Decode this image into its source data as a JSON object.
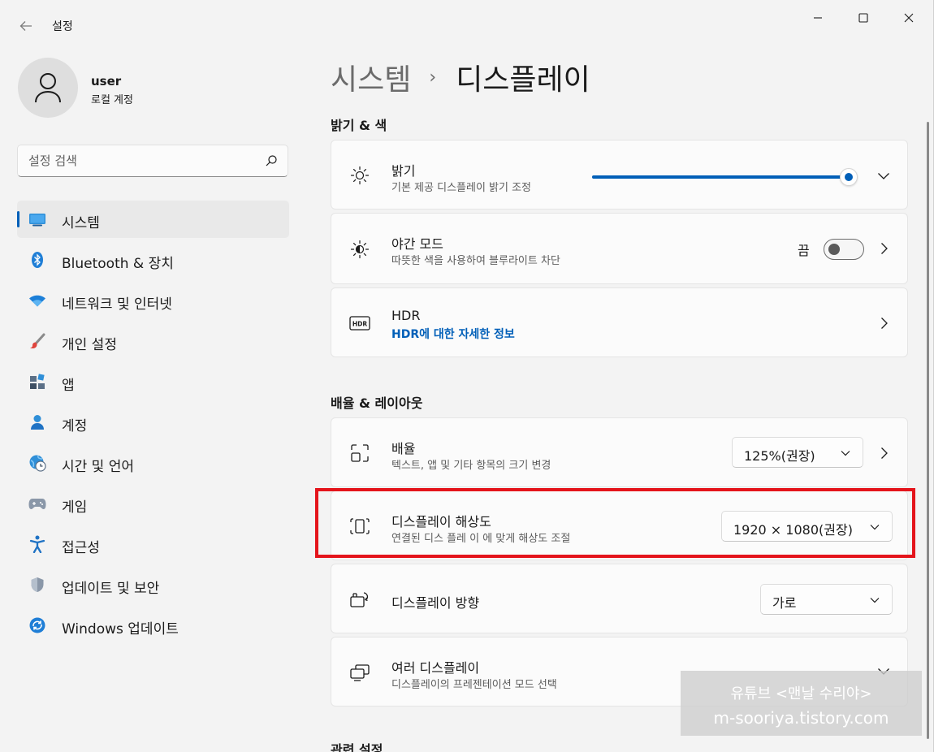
{
  "window": {
    "title": "설정"
  },
  "profile": {
    "name": "user",
    "account_type": "로컬 계정"
  },
  "search": {
    "placeholder": "설정 검색"
  },
  "sidebar": {
    "items": [
      {
        "label": "시스템",
        "icon": "system-monitor-icon",
        "active": true
      },
      {
        "label": "Bluetooth & 장치",
        "icon": "bluetooth-icon"
      },
      {
        "label": "네트워크 및 인터넷",
        "icon": "wifi-icon"
      },
      {
        "label": "개인 설정",
        "icon": "paintbrush-icon"
      },
      {
        "label": "앱",
        "icon": "apps-icon"
      },
      {
        "label": "계정",
        "icon": "account-icon"
      },
      {
        "label": "시간 및 언어",
        "icon": "globe-clock-icon"
      },
      {
        "label": "게임",
        "icon": "gamepad-icon"
      },
      {
        "label": "접근성",
        "icon": "accessibility-icon"
      },
      {
        "label": "업데이트 및 보안",
        "icon": "shield-icon"
      },
      {
        "label": "Windows 업데이트",
        "icon": "windows-update-icon"
      }
    ]
  },
  "breadcrumb": {
    "parent": "시스템",
    "separator": "›",
    "current": "디스플레이"
  },
  "sections": {
    "brightness_color": {
      "title": "밝기 & 색",
      "brightness": {
        "title": "밝기",
        "subtitle": "기본 제공 디스플레이 밝기 조정",
        "value": 1.0
      },
      "night_mode": {
        "title": "야간 모드",
        "subtitle": "따뜻한 색을 사용하여 블루라이트 차단",
        "state_label": "끔"
      },
      "hdr": {
        "title": "HDR",
        "link": "HDR에 대한 자세한 정보"
      }
    },
    "scale_layout": {
      "title": "배율 & 레이아웃",
      "scale": {
        "title": "배율",
        "subtitle": "텍스트, 앱 및 기타 항목의 크기 변경",
        "value": "125%(권장)"
      },
      "resolution": {
        "title": "디스플레이 해상도",
        "subtitle": "연결된 디스 플레 이 에 맞게 해상도 조절",
        "value": "1920 × 1080(권장)"
      },
      "orientation": {
        "title": "디스플레이 방향",
        "value": "가로"
      },
      "multiple": {
        "title": "여러 디스플레이",
        "subtitle": "디스플레이의 프레젠테이션 모드 선택"
      }
    },
    "related": {
      "title": "관련 설정"
    }
  },
  "watermark": {
    "line1": "유튜브 <맨날 수리야>",
    "line2": "m-sooriya.tistory.com"
  },
  "colors": {
    "accent": "#005fb8",
    "highlight": "#e4141b",
    "background": "#f3f3f3",
    "card": "#fbfbfb"
  }
}
